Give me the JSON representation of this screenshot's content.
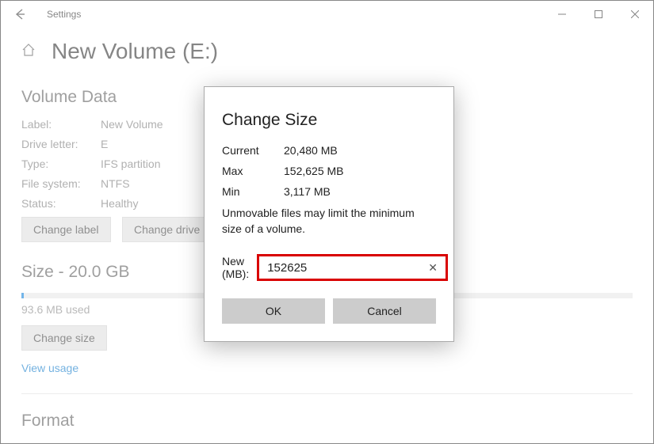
{
  "window": {
    "app_title": "Settings"
  },
  "page": {
    "title": "New Volume (E:)"
  },
  "volume_data": {
    "section_title": "Volume Data",
    "rows": {
      "label_key": "Label:",
      "label_val": "New Volume",
      "drive_key": "Drive letter:",
      "drive_val": "E",
      "type_key": "Type:",
      "type_val": "IFS partition",
      "fs_key": "File system:",
      "fs_val": "NTFS",
      "status_key": "Status:",
      "status_val": "Healthy"
    },
    "buttons": {
      "change_label": "Change label",
      "change_drive_letter": "Change drive letter"
    }
  },
  "size": {
    "section_title": "Size - 20.0 GB",
    "used_text": "93.6 MB used",
    "change_size": "Change size",
    "view_usage": "View usage"
  },
  "format": {
    "section_title": "Format"
  },
  "dialog": {
    "title": "Change Size",
    "current_key": "Current",
    "current_val": "20,480 MB",
    "max_key": "Max",
    "max_val": "152,625 MB",
    "min_key": "Min",
    "min_val": "3,117 MB",
    "note": "Unmovable files may limit the minimum size of a volume.",
    "new_label": "New (MB):",
    "new_value": "152625",
    "ok": "OK",
    "cancel": "Cancel"
  }
}
